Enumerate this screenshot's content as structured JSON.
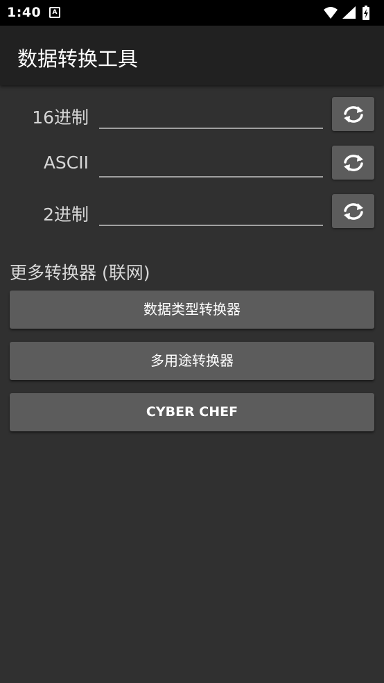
{
  "status_bar": {
    "time": "1:40",
    "notification_icon_letter": "A",
    "icons": [
      "wifi-icon",
      "signal-icon",
      "battery-icon"
    ]
  },
  "app_bar": {
    "title": "数据转换工具"
  },
  "fields": [
    {
      "label": "16进制",
      "value": "",
      "placeholder": ""
    },
    {
      "label": "ASCII",
      "value": "",
      "placeholder": ""
    },
    {
      "label": "2进制",
      "value": "",
      "placeholder": ""
    }
  ],
  "swap_icon": "refresh-icon",
  "more_section": {
    "title": "更多转换器 (联网)",
    "buttons": [
      {
        "label": "数据类型转换器"
      },
      {
        "label": "多用途转换器"
      },
      {
        "label": "CYBER CHEF"
      }
    ]
  },
  "colors": {
    "background": "#303030",
    "app_bar": "#212121",
    "button": "#5c5c5c",
    "underline": "#a0a0a0"
  }
}
